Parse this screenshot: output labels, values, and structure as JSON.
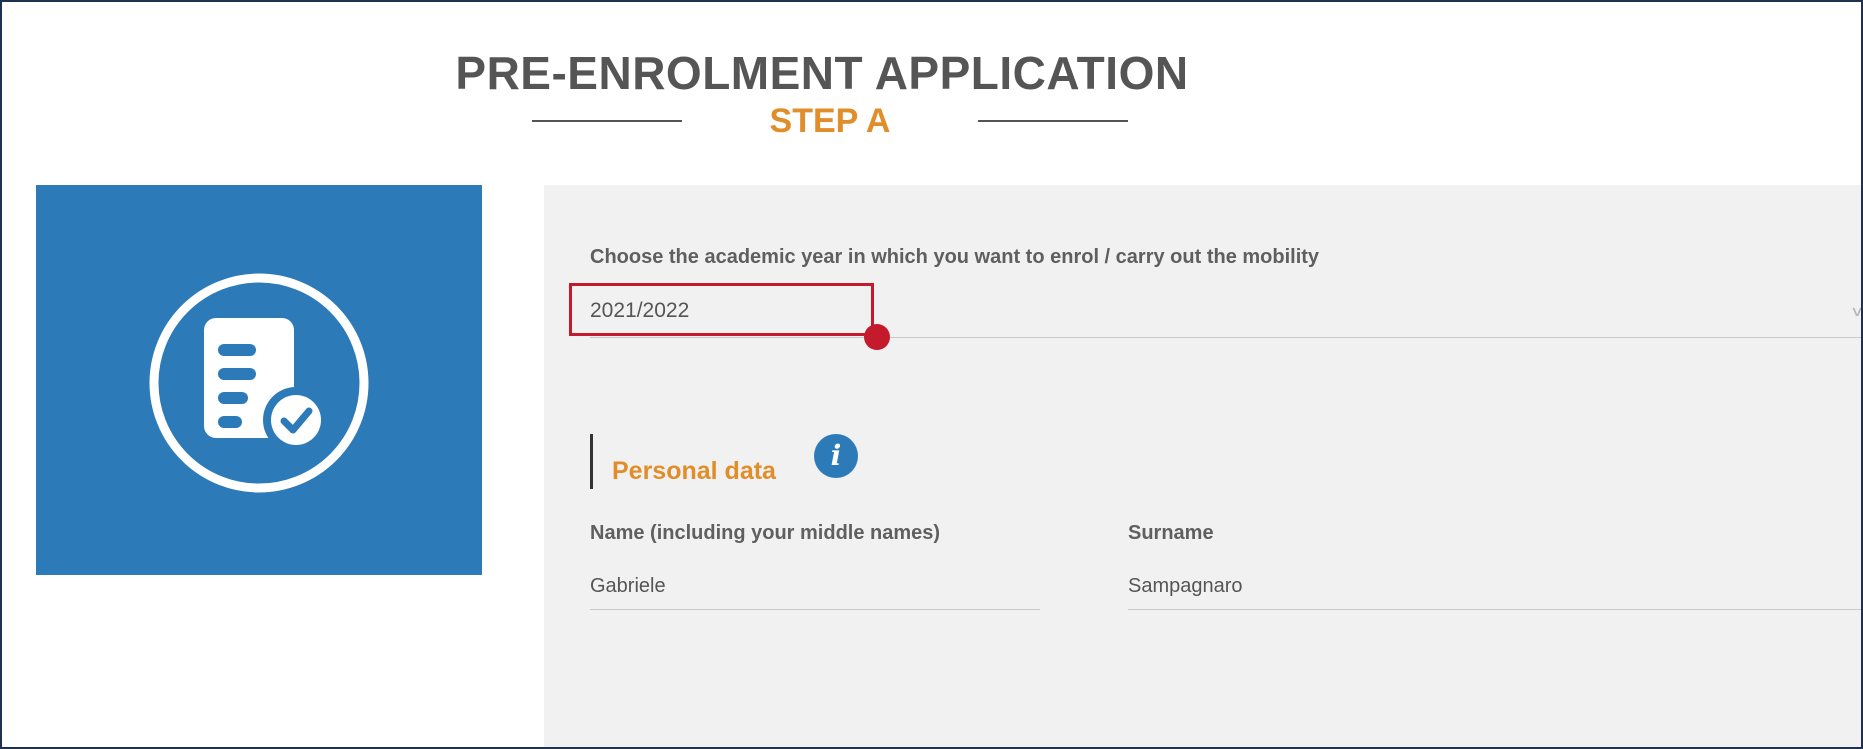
{
  "header": {
    "title": "PRE-ENROLMENT APPLICATION",
    "step": "STEP A"
  },
  "hero": {
    "icon": "document-check-icon",
    "background_color": "#2c7ab8"
  },
  "academic_year": {
    "label": "Choose the academic year in which you want to enrol / carry out the mobility",
    "selected": "2021/2022"
  },
  "personal_data": {
    "section_title": "Personal data",
    "info_icon": "i",
    "name": {
      "label": "Name (including your middle names)",
      "value": "Gabriele"
    },
    "surname": {
      "label": "Surname",
      "value": "Sampagnaro"
    }
  },
  "colors": {
    "accent": "#e08d2a",
    "brand_blue": "#2c7ab8",
    "highlight": "#c41a2b"
  }
}
